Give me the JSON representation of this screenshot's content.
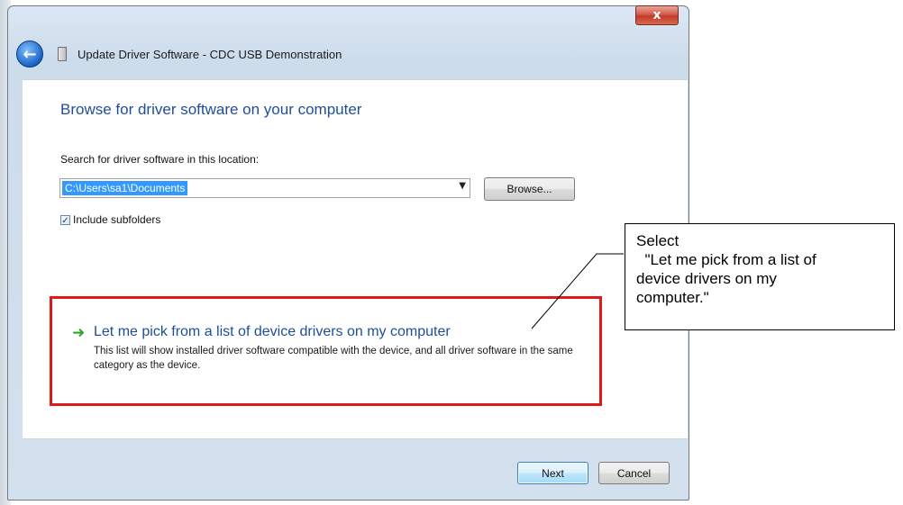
{
  "window": {
    "title": "Update Driver Software - CDC USB Demonstration",
    "close_label": "x"
  },
  "page": {
    "heading": "Browse for driver software on your computer",
    "search_label": "Search for driver software in this location:",
    "path_value": "C:\\Users\\sa1\\Documents",
    "browse_label": "Browse...",
    "include_subfolders_label": "Include subfolders",
    "include_subfolders_checked": true
  },
  "pick_option": {
    "title": "Let me pick from a list of device drivers on my computer",
    "description": "This list will show installed driver software compatible with the device, and all driver software in the same category as the device."
  },
  "footer": {
    "next_label": "Next",
    "cancel_label": "Cancel"
  },
  "callout": {
    "lines": [
      "Select",
      "  \"Let me pick from a list of",
      "device drivers on my",
      "computer.\""
    ]
  },
  "colors": {
    "heading_blue": "#1e4e9a",
    "highlight_red": "#e01818",
    "arrow_green": "#2ea52e",
    "selection_blue": "#3399ff"
  }
}
